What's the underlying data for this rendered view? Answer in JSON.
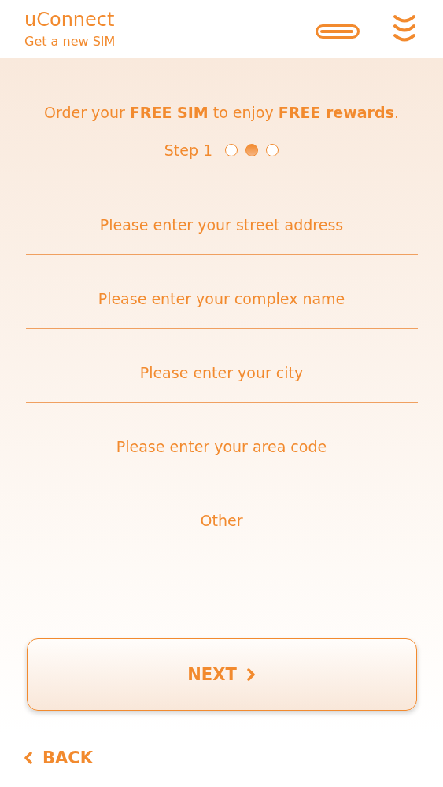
{
  "header": {
    "title": "uConnect",
    "subtitle": "Get a new SIM"
  },
  "intro": "Order your **FREE SIM** to enjoy **FREE rewards**.",
  "step": {
    "label": "Step 1",
    "dots": [
      {
        "selected": false
      },
      {
        "selected": true
      },
      {
        "selected": false
      }
    ]
  },
  "fields": [
    {
      "placeholder": "Please enter your street address"
    },
    {
      "placeholder": "Please enter your complex name"
    },
    {
      "placeholder": "Please enter your city"
    },
    {
      "placeholder": "Please enter your area code"
    },
    {
      "placeholder": "Other"
    }
  ],
  "next_button": "NEXT",
  "back_link": "BACK"
}
